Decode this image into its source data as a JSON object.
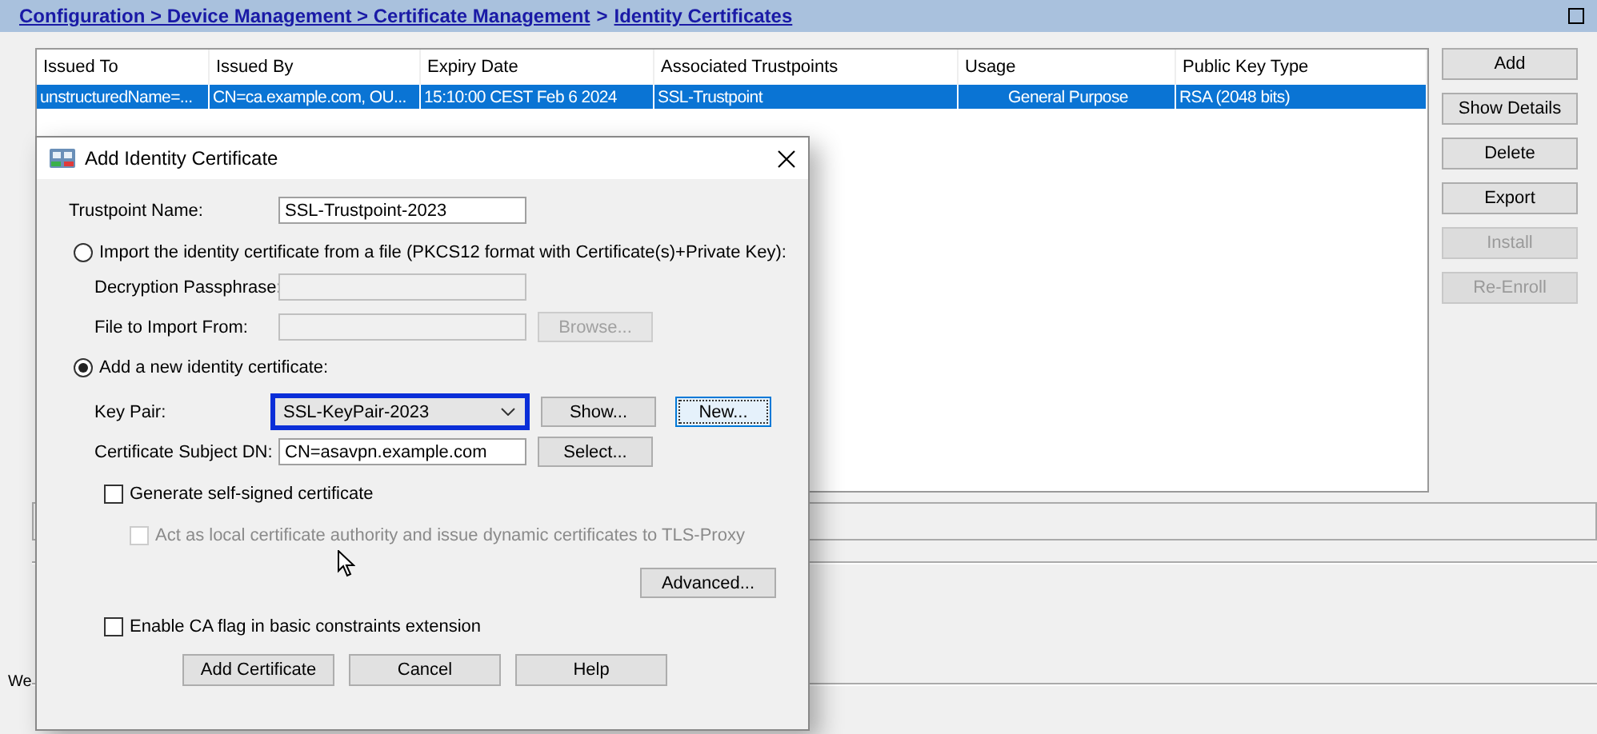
{
  "breadcrumb": [
    {
      "kind": "link",
      "label": "Configuration > Device Management > Certificate Management"
    },
    {
      "kind": "separator",
      "label": ">"
    },
    {
      "kind": "link",
      "label": "Identity Certificates"
    }
  ],
  "table": {
    "columns": [
      "Issued To",
      "Issued By",
      "Expiry Date",
      "Associated Trustpoints",
      "Usage",
      "Public Key Type"
    ],
    "rows": [
      {
        "selected": true,
        "cells": [
          "unstructuredName=...",
          "CN=ca.example.com, OU...",
          "15:10:00 CEST Feb 6 2024",
          "SSL-Trustpoint",
          "General Purpose",
          "RSA (2048 bits)"
        ]
      }
    ]
  },
  "side_buttons": [
    {
      "label": "Add",
      "disabled": false
    },
    {
      "label": "Show Details",
      "disabled": false
    },
    {
      "label": "Delete",
      "disabled": false
    },
    {
      "label": "Export",
      "disabled": false
    },
    {
      "label": "Install",
      "disabled": true
    },
    {
      "label": "Re-Enroll",
      "disabled": true
    }
  ],
  "status_text": "We",
  "dialog": {
    "title": "Add Identity Certificate",
    "trustpoint": {
      "label": "Trustpoint Name:",
      "value": "SSL-Trustpoint-2023"
    },
    "options": [
      {
        "label": "Import the identity certificate from a file (PKCS12 format with Certificate(s)+Private Key):",
        "selected": false
      },
      {
        "label": "Add a new identity certificate:",
        "selected": true
      }
    ],
    "import_fields": [
      {
        "label": "Decryption Passphrase:",
        "disabled": true
      },
      {
        "label": "File to Import From:",
        "disabled": true,
        "button": {
          "label": "Browse...",
          "disabled": true
        }
      }
    ],
    "key_pair": {
      "label": "Key Pair:",
      "value": "SSL-KeyPair-2023",
      "highlighted": true,
      "buttons": [
        {
          "label": "Show...",
          "focused": false
        },
        {
          "label": "New...",
          "focused": true
        }
      ]
    },
    "subject": {
      "label": "Certificate Subject DN:",
      "value": "CN=asavpn.example.com",
      "button": "Select..."
    },
    "checks": [
      {
        "label": "Generate self-signed certificate",
        "checked": false,
        "disabled": false,
        "indent": false
      },
      {
        "label": "Act as local certificate authority and issue dynamic certificates to TLS-Proxy",
        "checked": false,
        "disabled": true,
        "indent": true
      }
    ],
    "advanced": "Advanced...",
    "ca_flag": {
      "label": "Enable CA flag in basic constraints extension",
      "checked": false,
      "disabled": false
    },
    "buttons": [
      "Add Certificate",
      "Cancel",
      "Help"
    ]
  }
}
